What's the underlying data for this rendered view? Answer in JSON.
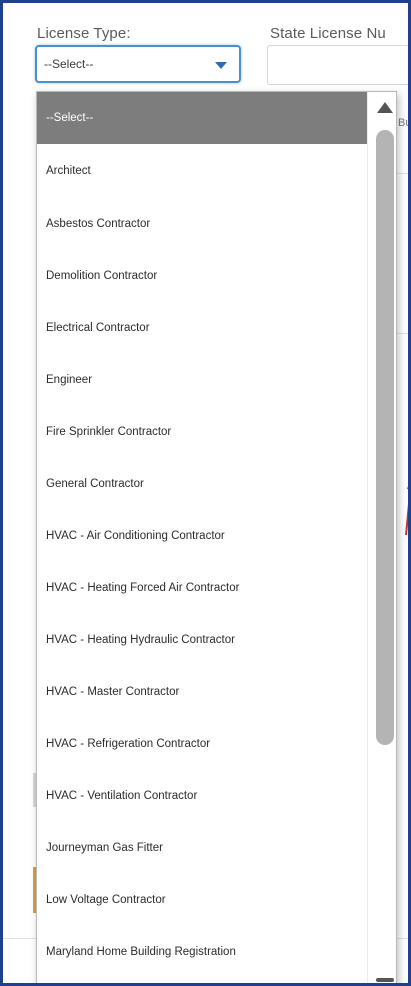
{
  "form": {
    "license_type_label": "License Type:",
    "state_license_label": "State License Nu",
    "selected_value": "--Select--",
    "bg_fragment": "Bu"
  },
  "dropdown": {
    "options": [
      "--Select--",
      "Architect",
      "Asbestos Contractor",
      "Demolition Contractor",
      "Electrical Contractor",
      "Engineer",
      "Fire Sprinkler Contractor",
      "General Contractor",
      "HVAC - Air Conditioning Contractor",
      "HVAC - Heating Forced Air Contractor",
      "HVAC - Heating Hydraulic Contractor",
      "HVAC - Master Contractor",
      "HVAC - Refrigeration Contractor",
      "HVAC - Ventilation Contractor",
      "Journeyman Gas Fitter",
      "Low Voltage Contractor",
      "Maryland Home Building Registration"
    ],
    "selected_index": 0
  },
  "colors": {
    "frame_border": "#1f3f8f",
    "focus_border": "#4a90c9",
    "selected_bg": "#7d7d7d",
    "caret": "#2a6fb5",
    "annotation_arrow": "#c0392b"
  }
}
